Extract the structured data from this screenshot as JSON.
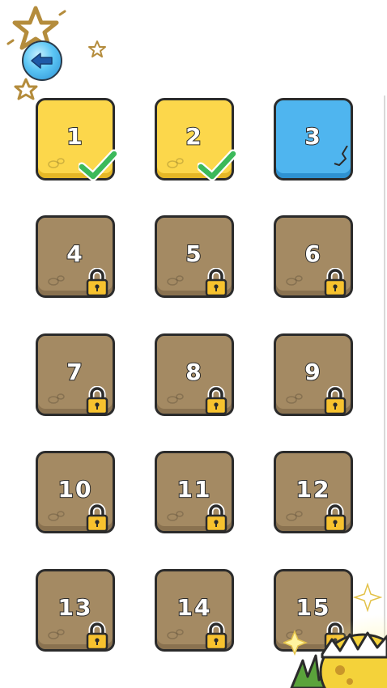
{
  "colors": {
    "completed": "#fcd74b",
    "current": "#4fb5ef",
    "locked": "#a48a63",
    "check": "#3cb95a",
    "lock": "#f7c22e"
  },
  "nav": {
    "back_icon": "arrow-left-icon"
  },
  "levels": [
    {
      "label": "1",
      "state": "completed"
    },
    {
      "label": "2",
      "state": "completed"
    },
    {
      "label": "3",
      "state": "current"
    },
    {
      "label": "4",
      "state": "locked"
    },
    {
      "label": "5",
      "state": "locked"
    },
    {
      "label": "6",
      "state": "locked"
    },
    {
      "label": "7",
      "state": "locked"
    },
    {
      "label": "8",
      "state": "locked"
    },
    {
      "label": "9",
      "state": "locked"
    },
    {
      "label": "10",
      "state": "locked"
    },
    {
      "label": "11",
      "state": "locked"
    },
    {
      "label": "12",
      "state": "locked"
    },
    {
      "label": "13",
      "state": "locked"
    },
    {
      "label": "14",
      "state": "locked"
    },
    {
      "label": "15",
      "state": "locked"
    }
  ]
}
